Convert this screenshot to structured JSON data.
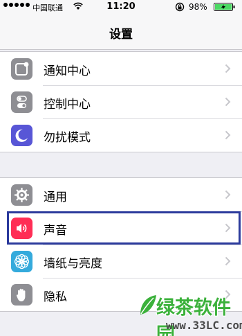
{
  "status_bar": {
    "carrier": "中国联通",
    "time": "11:20",
    "battery_percent": "98%"
  },
  "nav": {
    "title": "设置"
  },
  "groups": [
    {
      "items": [
        {
          "label": "通知中心",
          "icon": "notification-center-icon",
          "color": "#8e8e93"
        },
        {
          "label": "控制中心",
          "icon": "control-center-icon",
          "color": "#8e8e93"
        },
        {
          "label": "勿扰模式",
          "icon": "moon-icon",
          "color": "#5856d6"
        }
      ]
    },
    {
      "items": [
        {
          "label": "通用",
          "icon": "gear-icon",
          "color": "#8e8e93"
        },
        {
          "label": "声音",
          "icon": "speaker-icon",
          "color": "#ff2d55"
        },
        {
          "label": "墙纸与亮度",
          "icon": "flower-icon",
          "color": "#34aadc"
        },
        {
          "label": "隐私",
          "icon": "hand-icon",
          "color": "#8e8e93"
        }
      ]
    }
  ],
  "watermark": {
    "name": "绿茶软件园",
    "url": "www.33LC.com"
  },
  "colors": {
    "background": "#efeff4",
    "highlight_border": "#2b3a9c",
    "battery": "#4cd964"
  }
}
